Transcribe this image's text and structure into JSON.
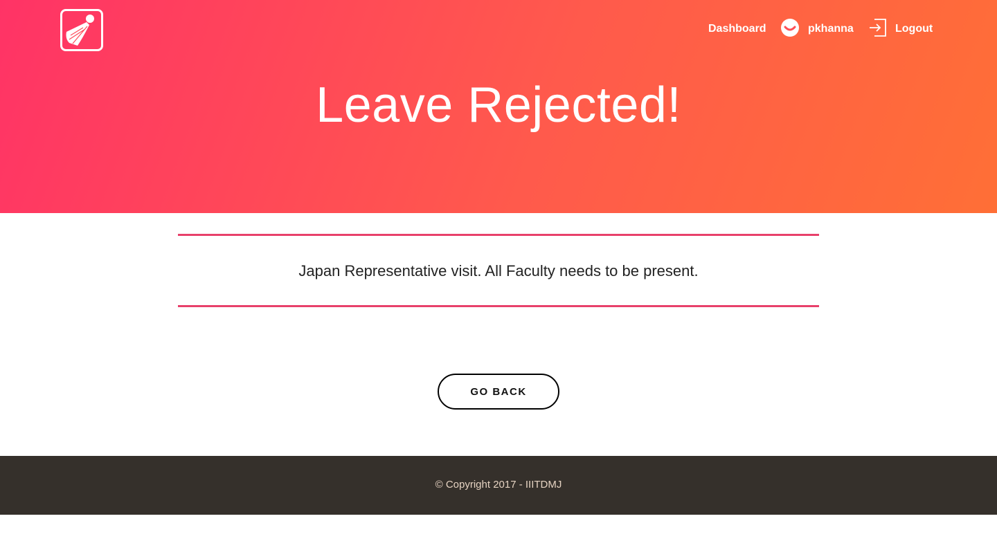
{
  "header": {
    "nav": {
      "dashboard_label": "Dashboard",
      "username": "pkhanna",
      "logout_label": "Logout"
    },
    "title": "Leave Rejected!"
  },
  "main": {
    "message": "Japan Representative visit. All Faculty needs to be present.",
    "go_back_label": "GO BACK"
  },
  "footer": {
    "copyright": "© Copyright 2017 - IIITDMJ"
  },
  "colors": {
    "gradient_start": "#ff3366",
    "gradient_end": "#ff6f36",
    "accent_line": "#e8406a",
    "footer_bg": "#35302b"
  },
  "icons": {
    "logo": "shuttlecock-logo-icon",
    "user": "smiley-user-icon",
    "logout": "logout-icon"
  }
}
